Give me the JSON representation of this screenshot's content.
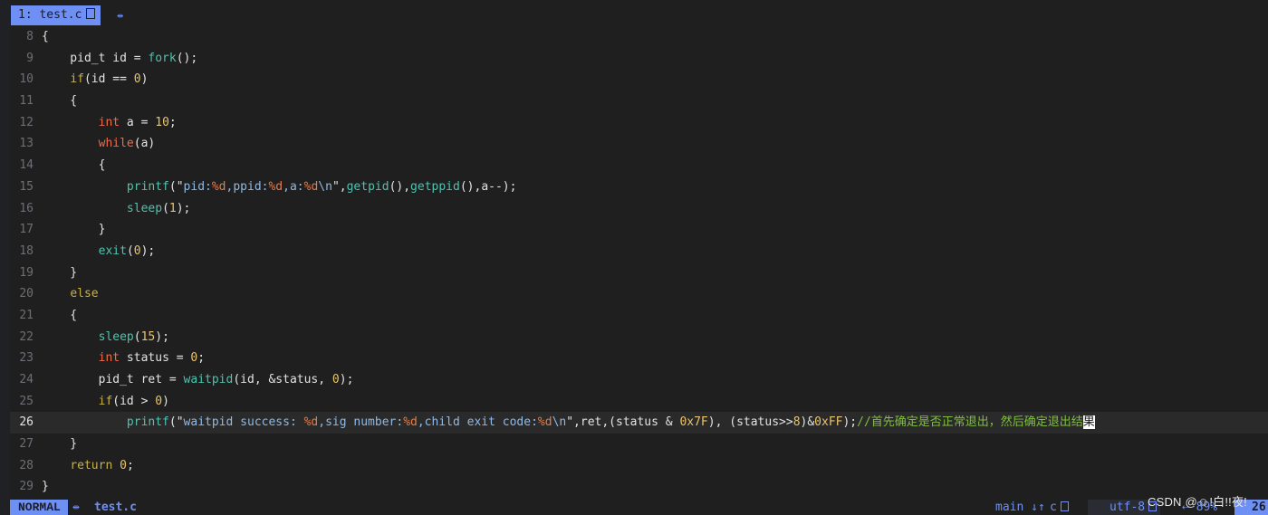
{
  "tabline": {
    "active_tab": "1: test.c",
    "close_glyph": "⇹"
  },
  "code_lines": [
    {
      "n": "8",
      "tokens": [
        [
          "t",
          "{"
        ]
      ]
    },
    {
      "n": "9",
      "tokens": [
        [
          "t",
          "    pid_t id = "
        ],
        [
          "fn",
          "fork"
        ],
        [
          "t",
          "();"
        ]
      ]
    },
    {
      "n": "10",
      "tokens": [
        [
          "t",
          "    "
        ],
        [
          "kw",
          "if"
        ],
        [
          "t",
          "(id == "
        ],
        [
          "num",
          "0"
        ],
        [
          "t",
          ")"
        ]
      ]
    },
    {
      "n": "11",
      "tokens": [
        [
          "t",
          "    {"
        ]
      ]
    },
    {
      "n": "12",
      "tokens": [
        [
          "t",
          "        "
        ],
        [
          "type",
          "int"
        ],
        [
          "t",
          " a = "
        ],
        [
          "num",
          "10"
        ],
        [
          "t",
          ";"
        ]
      ]
    },
    {
      "n": "13",
      "tokens": [
        [
          "t",
          "        "
        ],
        [
          "type",
          "while"
        ],
        [
          "t",
          "(a)"
        ]
      ]
    },
    {
      "n": "14",
      "tokens": [
        [
          "t",
          "        {"
        ]
      ]
    },
    {
      "n": "15",
      "tokens": [
        [
          "t",
          "            "
        ],
        [
          "fn",
          "printf"
        ],
        [
          "t",
          "(\""
        ],
        [
          "str",
          "pid:"
        ],
        [
          "fmt",
          "%d"
        ],
        [
          "str",
          ",ppid:"
        ],
        [
          "fmt",
          "%d"
        ],
        [
          "str",
          ",a:"
        ],
        [
          "fmt",
          "%d"
        ],
        [
          "str",
          "\\n"
        ],
        [
          "t",
          "\","
        ],
        [
          "fn",
          "getpid"
        ],
        [
          "t",
          "(),"
        ],
        [
          "fn",
          "getppid"
        ],
        [
          "t",
          "(),a--);"
        ]
      ]
    },
    {
      "n": "16",
      "tokens": [
        [
          "t",
          "            "
        ],
        [
          "fn",
          "sleep"
        ],
        [
          "t",
          "("
        ],
        [
          "num",
          "1"
        ],
        [
          "t",
          ");"
        ]
      ]
    },
    {
      "n": "17",
      "tokens": [
        [
          "t",
          "        }"
        ]
      ]
    },
    {
      "n": "18",
      "tokens": [
        [
          "t",
          "        "
        ],
        [
          "fn",
          "exit"
        ],
        [
          "t",
          "("
        ],
        [
          "num",
          "0"
        ],
        [
          "t",
          ");"
        ]
      ]
    },
    {
      "n": "19",
      "tokens": [
        [
          "t",
          "    }"
        ]
      ]
    },
    {
      "n": "20",
      "tokens": [
        [
          "t",
          "    "
        ],
        [
          "kw",
          "else"
        ]
      ]
    },
    {
      "n": "21",
      "tokens": [
        [
          "t",
          "    {"
        ]
      ]
    },
    {
      "n": "22",
      "tokens": [
        [
          "t",
          "        "
        ],
        [
          "fn",
          "sleep"
        ],
        [
          "t",
          "("
        ],
        [
          "num",
          "15"
        ],
        [
          "t",
          ");"
        ]
      ]
    },
    {
      "n": "23",
      "tokens": [
        [
          "t",
          "        "
        ],
        [
          "type",
          "int"
        ],
        [
          "t",
          " status = "
        ],
        [
          "num",
          "0"
        ],
        [
          "t",
          ";"
        ]
      ]
    },
    {
      "n": "24",
      "tokens": [
        [
          "t",
          "        pid_t ret = "
        ],
        [
          "fn",
          "waitpid"
        ],
        [
          "t",
          "(id, &status, "
        ],
        [
          "num",
          "0"
        ],
        [
          "t",
          ");"
        ]
      ]
    },
    {
      "n": "25",
      "tokens": [
        [
          "t",
          "        "
        ],
        [
          "kw",
          "if"
        ],
        [
          "t",
          "(id > "
        ],
        [
          "num",
          "0"
        ],
        [
          "t",
          ")"
        ]
      ]
    },
    {
      "n": "26",
      "current": true,
      "tokens": [
        [
          "t",
          "            "
        ],
        [
          "fn",
          "printf"
        ],
        [
          "t",
          "(\""
        ],
        [
          "str",
          "waitpid success: "
        ],
        [
          "fmt",
          "%d"
        ],
        [
          "str",
          ",sig number:"
        ],
        [
          "fmt",
          "%d"
        ],
        [
          "str",
          ",child exit code:"
        ],
        [
          "fmt",
          "%d"
        ],
        [
          "str",
          "\\n"
        ],
        [
          "t",
          "\",ret,(status & "
        ],
        [
          "num",
          "0x7F"
        ],
        [
          "t",
          "), (status>>"
        ],
        [
          "num",
          "8"
        ],
        [
          "t",
          ")&"
        ],
        [
          "num",
          "0xFF"
        ],
        [
          "t",
          ");"
        ],
        [
          "cmt",
          "//首先确定是否正常退出，然后确定退出结"
        ],
        [
          "cur",
          "果"
        ]
      ]
    },
    {
      "n": "27",
      "tokens": [
        [
          "t",
          "    }"
        ]
      ]
    },
    {
      "n": "28",
      "tokens": [
        [
          "t",
          "    "
        ],
        [
          "kw",
          "return"
        ],
        [
          "t",
          " "
        ],
        [
          "num",
          "0"
        ],
        [
          "t",
          ";"
        ]
      ]
    },
    {
      "n": "29",
      "tokens": [
        [
          "t",
          "}"
        ]
      ]
    }
  ],
  "statusline": {
    "mode": "NORMAL",
    "sep_glyph": "⇹",
    "filename": "test.c",
    "branch": "main",
    "branch_glyph": "↓↑",
    "filetype": "c",
    "encoding": "utf-8",
    "percent_glyph": "⇠",
    "percent": "89%",
    "line": "26"
  },
  "watermark": "CSDN @☺ǃ白ǃǃ夜ǃ",
  "colors": {
    "accent": "#6e8ff3",
    "keyword": "#c9b04a",
    "type": "#ec6b49",
    "function": "#4ec3b0",
    "number": "#e9c46a",
    "string": "#8fb9e6",
    "comment": "#7fbf3f"
  }
}
